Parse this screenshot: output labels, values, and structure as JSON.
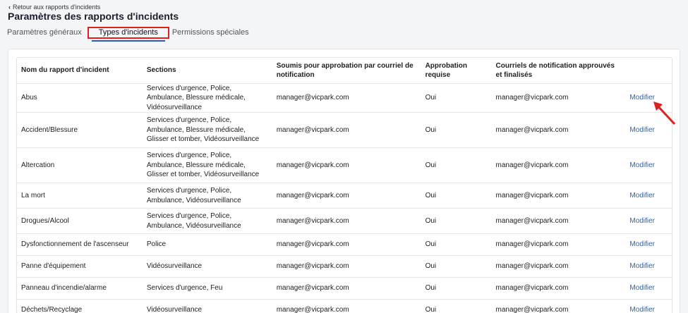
{
  "header": {
    "back_label": "Retour aux rapports d'incidents",
    "title": "Paramètres des rapports d'incidents"
  },
  "tabs": [
    {
      "label": "Paramètres généraux"
    },
    {
      "label": "Types d'incidents"
    },
    {
      "label": "Permissions spéciales"
    }
  ],
  "table": {
    "headers": {
      "name": "Nom du rapport d'incident",
      "sections": "Sections",
      "submitted": "Soumis pour approbation par courriel de notification",
      "approval": "Approbation requise",
      "notify": "Courriels de notification approuvés et finalisés"
    },
    "rows": [
      {
        "name": "Abus",
        "sections": "Services d'urgence, Police, Ambulance, Blessure médicale, Vidéosurveillance",
        "submitted": "manager@vicpark.com",
        "approval": "Oui",
        "notify": "manager@vicpark.com",
        "action": "Modifier"
      },
      {
        "name": "Accident/Blessure",
        "sections": "Services d'urgence, Police, Ambulance, Blessure médicale, Glisser et tomber, Vidéosurveillance",
        "submitted": "manager@vicpark.com",
        "approval": "Oui",
        "notify": "manager@vicpark.com",
        "action": "Modifier"
      },
      {
        "name": "Altercation",
        "sections": "Services d'urgence, Police, Ambulance, Blessure médicale, Glisser et tomber, Vidéosurveillance",
        "submitted": "manager@vicpark.com",
        "approval": "Oui",
        "notify": "manager@vicpark.com",
        "action": "Modifier"
      },
      {
        "name": "La mort",
        "sections": "Services d'urgence, Police, Ambulance, Vidéosurveillance",
        "submitted": "manager@vicpark.com",
        "approval": "Oui",
        "notify": "manager@vicpark.com",
        "action": "Modifier"
      },
      {
        "name": "Drogues/Alcool",
        "sections": "Services d'urgence, Police, Ambulance, Vidéosurveillance",
        "submitted": "manager@vicpark.com",
        "approval": "Oui",
        "notify": "manager@vicpark.com",
        "action": "Modifier"
      },
      {
        "name": "Dysfonctionnement de l'ascenseur",
        "sections": "Police",
        "submitted": "manager@vicpark.com",
        "approval": "Oui",
        "notify": "manager@vicpark.com",
        "action": "Modifier"
      },
      {
        "name": "Panne d'équipement",
        "sections": "Vidéosurveillance",
        "submitted": "manager@vicpark.com",
        "approval": "Oui",
        "notify": "manager@vicpark.com",
        "action": "Modifier"
      },
      {
        "name": "Panneau d'incendie/alarme",
        "sections": "Services d'urgence, Feu",
        "submitted": "manager@vicpark.com",
        "approval": "Oui",
        "notify": "manager@vicpark.com",
        "action": "Modifier"
      },
      {
        "name": "Déchets/Recyclage",
        "sections": "Vidéosurveillance",
        "submitted": "manager@vicpark.com",
        "approval": "Oui",
        "notify": "manager@vicpark.com",
        "action": "Modifier"
      }
    ]
  },
  "colors": {
    "accent": "#2a63b0",
    "highlight": "#e02020",
    "tab_underline": "#2f5bb7"
  }
}
